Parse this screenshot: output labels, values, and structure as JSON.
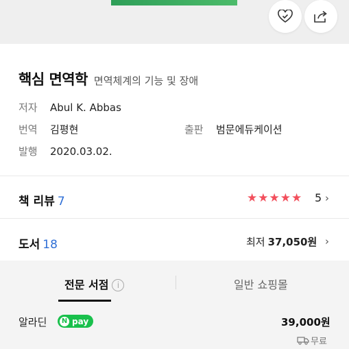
{
  "actions": {
    "like_icon": "heart-check-icon",
    "share_icon": "share-icon"
  },
  "book": {
    "title": "핵심 면역학",
    "subtitle": "면역체계의 기능 및 장애",
    "author_label": "저자",
    "author": "Abul K. Abbas",
    "translator_label": "번역",
    "translator": "김평현",
    "publisher_label": "출판",
    "publisher": "범문에듀케이션",
    "published_label": "발행",
    "published": "2020.03.02."
  },
  "reviews": {
    "label": "책 리뷰",
    "count": "7",
    "rating": "5",
    "star_rating": 5
  },
  "stores": {
    "label": "도서",
    "count": "18",
    "lowest_label": "최저",
    "lowest_price": "37,050원"
  },
  "tabs": [
    {
      "label": "전문 서점",
      "active": true
    },
    {
      "label": "일반 쇼핑몰",
      "active": false
    }
  ],
  "offer": {
    "store": "알라딘",
    "badge": "pay",
    "price": "39,000원",
    "shipping": "무료"
  },
  "colors": {
    "star": "#f24f5c",
    "count_link": "#2f6fd6",
    "npay": "#19c04c"
  }
}
